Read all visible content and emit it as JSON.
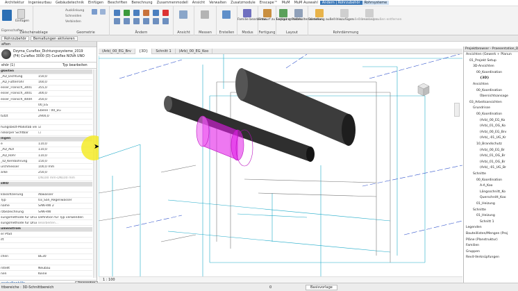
{
  "menubar": {
    "items": [
      "Architektur",
      "Ingenieurbau",
      "Gebäudetechnik",
      "Einfügen",
      "Beschriften",
      "Berechnung",
      "Zusammenmodell",
      "Ansicht",
      "Verwalten",
      "Zusatzmodule",
      "Enscape™",
      "MuM",
      "MuM Auswahl",
      "Ändern | Rohrzubehör",
      "Rohrsysteme"
    ]
  },
  "ribbon": {
    "groups": {
      "zwischenablage": "Zwischenablage",
      "geometrie": "Geometrie",
      "aendern": "Ändern",
      "ansicht": "Ansicht",
      "messen": "Messen",
      "erstellen": "Erstellen",
      "modus": "Modus",
      "fertigung": "Fertigung",
      "layout": "Layout",
      "rohrdaemmung": "Rohrdämmung",
      "eigenschaften": "Eigenschaften"
    },
    "buttons": {
      "einfuegen": "Einfügen",
      "ausklinkung": "Ausklinkung",
      "schneiden": "Schneiden",
      "verbinden": "Verbinden",
      "familie": "Familie bearbeiten",
      "entwurf": "Entwurf zu Fertigung",
      "layout": "Layout erstellen",
      "platzhalter": "Platzhalter erstellen",
      "daemmung_add": "Dämmung außen hinzufügen",
      "daemmung_edit": "Dämmung außen bearbeiten",
      "daemmung_rm": "Dämmung außen entfernen"
    }
  },
  "contextbar": {
    "type": "Rohrzubehör",
    "btn": "Bemaßungen aktivieren"
  },
  "properties": {
    "title": "aften",
    "family_name": "Dzyma_Curaflex_Dichtungssysteme_2019",
    "family_type": "(F4) Curaflex 3000 (D) Curaflex NOVA UNO",
    "selector": "ehör (1)",
    "edit_type": "Typ bearbeiten",
    "rows": [
      {
        "k": "gkeiten",
        "v": "",
        "sec": true
      },
      {
        "k": "_AD_Dichtung",
        "v": "150,0"
      },
      {
        "k": "_AD_Futterrohr",
        "v": "160,0"
      },
      {
        "k": "esser_Flansch_3001",
        "v": "355,0"
      },
      {
        "k": "esser_Flansch_3001",
        "v": "300,0"
      },
      {
        "k": "esser_Flansch_400R",
        "v": "350,0"
      },
      {
        "k": "",
        "v": "00_EG"
      },
      {
        "k": "",
        "v": "Ebene : 00_EG"
      },
      {
        "k": "tutzt",
        "v": "2900,0"
      },
      {
        "k": "",
        "v": ""
      },
      {
        "k": "hungsbezt-Maßstab ver...",
        "v": "☑"
      },
      {
        "k": "nskörper Sichtbar",
        "v": "☐"
      },
      {
        "k": "ingen",
        "v": "",
        "sec": true
      },
      {
        "k": "e",
        "v": "110,0"
      },
      {
        "k": "_AD_ADI",
        "v": "110,0"
      },
      {
        "k": "_AD_Rohr",
        "v": "110,0"
      },
      {
        "k": "_ID_Kernbohrung",
        "v": "150,0"
      },
      {
        "k": "urchmesser",
        "v": "100,0 mm"
      },
      {
        "k": "ärke",
        "v": "250,0"
      },
      {
        "k": "",
        "v": "DN100 mm-DN100 mm",
        "gray": true
      },
      {
        "k": "sWD",
        "v": "",
        "sec": true
      },
      {
        "k": "",
        "v": ""
      },
      {
        "k": "klassifizierung",
        "v": "Abwasser"
      },
      {
        "k": "Typ",
        "v": "03_San_Regenwasser"
      },
      {
        "k": "name",
        "v": "SAN-RW 2"
      },
      {
        "k": "rzbezeichnung",
        "v": "SAN-RW"
      },
      {
        "k": "sungsmethode für Druc...",
        "v": "Definition für Typ verwenden"
      },
      {
        "k": "sungsmethode für Druc...",
        "v": "Bearbeiten...",
        "gray": true
      },
      {
        "k": "umenstrom",
        "v": "",
        "sec": true
      },
      {
        "k": "er Pfad",
        "v": "",
        "gray": true
      },
      {
        "k": "ift",
        "v": ""
      },
      {
        "k": "",
        "v": ""
      },
      {
        "k": "",
        "v": ""
      },
      {
        "k": "chen",
        "v": "BE30"
      },
      {
        "k": "",
        "v": ""
      },
      {
        "k": "rstellt",
        "v": "Neubau"
      },
      {
        "k": "nen",
        "v": "Keine"
      }
    ],
    "help_link": "nschaftenhilfe",
    "apply": "Anwenden"
  },
  "tabs": [
    "(Arb)_00_EG_Brv",
    "{3D}",
    "Schnitt 1",
    "(Arb)_00_EG_Koo"
  ],
  "viewcontrol": {
    "scale": "1 : 100"
  },
  "status": {
    "left": "ttbereiche : 3D-Schnittbereich",
    "mid": "0",
    "workset": "Basisvorlage"
  },
  "browser": {
    "title": "Projektbrowser - Praesentation_Dicyi",
    "items": [
      {
        "t": "Ansichten (Gewerk + Planun",
        "d": 0
      },
      {
        "t": "01_Projekt Setup",
        "d": 1
      },
      {
        "t": "3D-Ansichten",
        "d": 2
      },
      {
        "t": "00_Koordination",
        "d": 3
      },
      {
        "t": "{3D}",
        "d": 4,
        "bold": true
      },
      {
        "t": "Ansichten",
        "d": 2
      },
      {
        "t": "00_Koordination",
        "d": 3
      },
      {
        "t": "Übersichtsansage",
        "d": 4
      },
      {
        "t": "03_Arbeitsansichten",
        "d": 1
      },
      {
        "t": "Grundrisse",
        "d": 2
      },
      {
        "t": "00_Koordination",
        "d": 3
      },
      {
        "t": "(Arb)_00_EG_Ko",
        "d": 4
      },
      {
        "t": "(Arb)_01_OG_Ko",
        "d": 4
      },
      {
        "t": "(Arb)_00_EG_Brv",
        "d": 4
      },
      {
        "t": "(Arb)_-01_UG_Kr",
        "d": 4
      },
      {
        "t": "10_Brandschutz",
        "d": 3
      },
      {
        "t": "(Arb)_00_EG_Br",
        "d": 4
      },
      {
        "t": "(Arb)_01_OG_Br",
        "d": 4
      },
      {
        "t": "(Arb)_01_OG_Br",
        "d": 4
      },
      {
        "t": "(Arb)_-01_UG_Br",
        "d": 4
      },
      {
        "t": "Schnitte",
        "d": 2
      },
      {
        "t": "00_Koordination",
        "d": 3
      },
      {
        "t": "A-A_Koo",
        "d": 4
      },
      {
        "t": "Längsschnitt_Ko",
        "d": 4
      },
      {
        "t": "Querschnitt_Koo",
        "d": 4
      },
      {
        "t": "01_Heizung",
        "d": 3
      },
      {
        "t": "Schnitte",
        "d": 2
      },
      {
        "t": "01_Heizung",
        "d": 3
      },
      {
        "t": "Schnitt 1",
        "d": 4
      },
      {
        "t": "Legenden",
        "d": 0
      },
      {
        "t": "Bauteillisten/Mengen (Proj",
        "d": 0
      },
      {
        "t": "Pläne (Planstruktur)",
        "d": 0
      },
      {
        "t": "Familien",
        "d": 0
      },
      {
        "t": "Gruppen",
        "d": 0
      },
      {
        "t": "Revit-Verknüpfungen",
        "d": 0
      }
    ]
  },
  "colors": {
    "accent": "#3a77b7",
    "magenta": "#e21ee8",
    "cyan": "#1ba9c8"
  }
}
